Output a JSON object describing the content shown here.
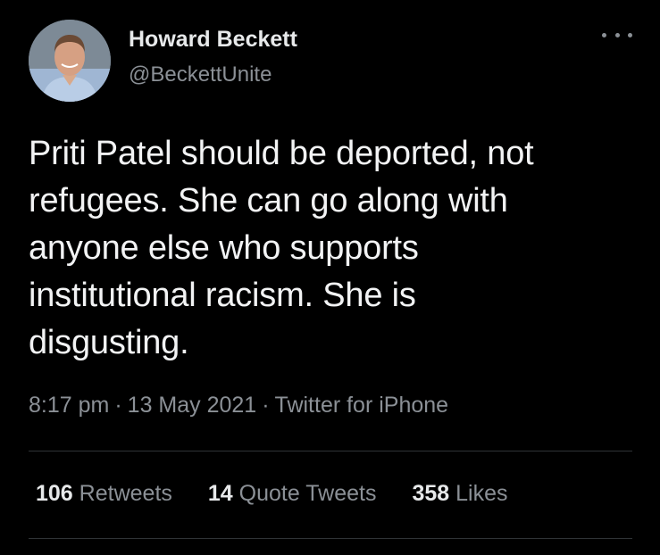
{
  "author": {
    "display_name": "Howard Beckett",
    "handle": "@BeckettUnite",
    "avatar_icon": "avatar-photo"
  },
  "more_icon": "more-options-icon",
  "tweet": {
    "lines": [
      "Priti Patel should be deported, not",
      "refugees. She can go along with",
      "anyone else who supports",
      "institutional racism. She is",
      "disgusting."
    ]
  },
  "meta": {
    "time": "8:17 pm",
    "date": "13 May 2021",
    "source": "Twitter for iPhone",
    "separator": "·"
  },
  "stats": {
    "retweets": {
      "count": "106",
      "label": "Retweets"
    },
    "quote_tweets": {
      "count": "14",
      "label": "Quote Tweets"
    },
    "likes": {
      "count": "358",
      "label": "Likes"
    }
  },
  "colors": {
    "background": "#000000",
    "primary_text": "#e7e9ea",
    "secondary_text": "#8b9096",
    "divider": "#2f3336"
  }
}
